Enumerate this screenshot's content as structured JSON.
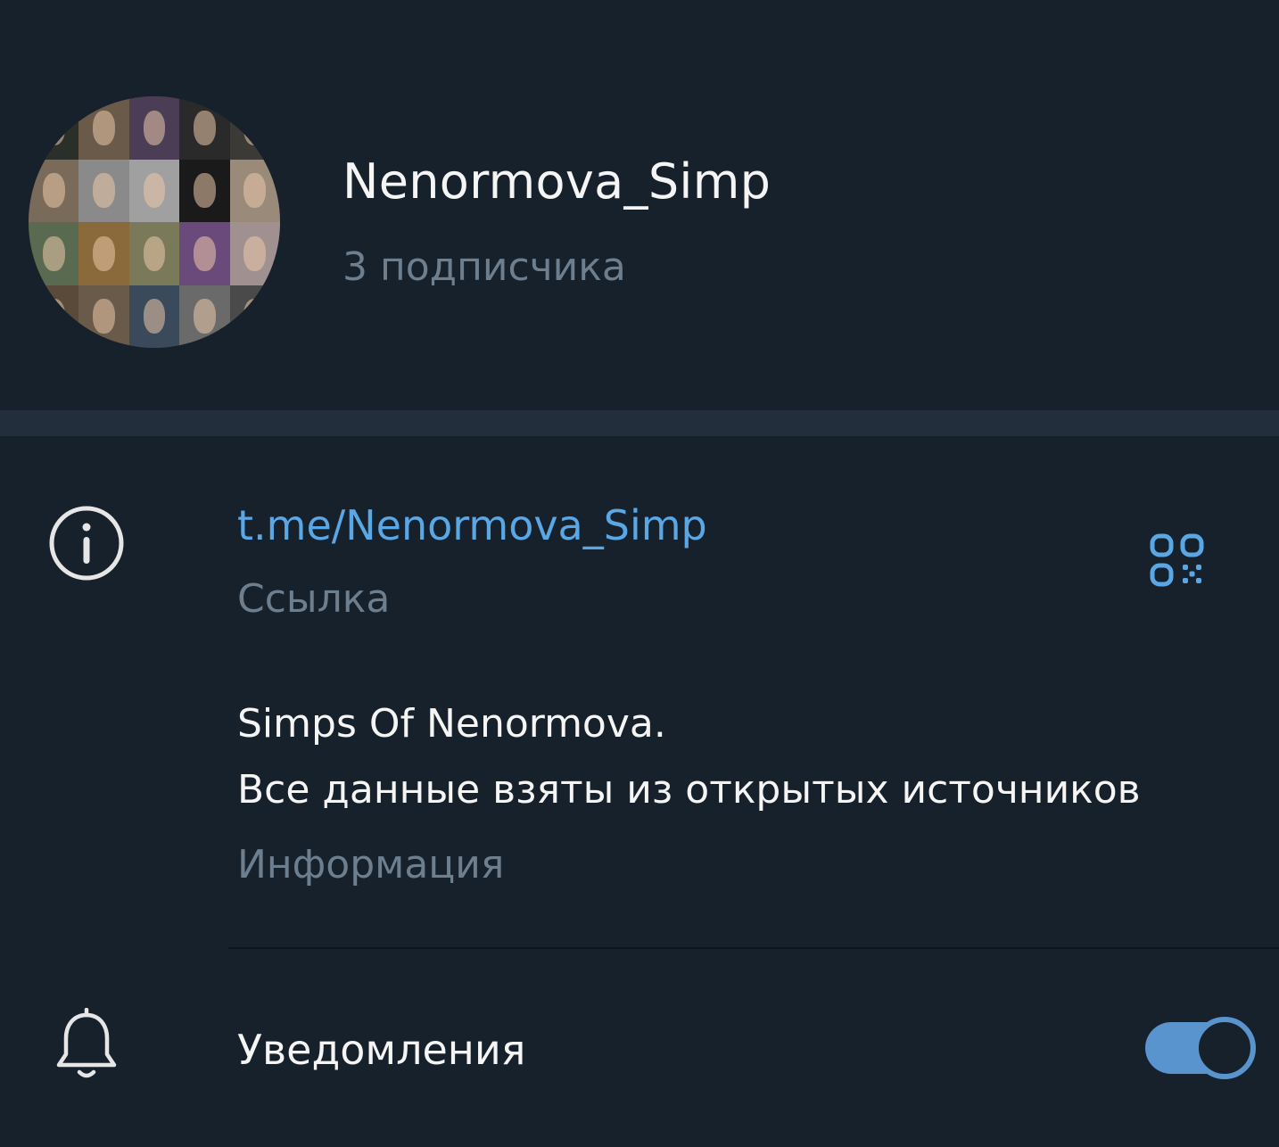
{
  "channel": {
    "name": "Nenormova_Simp",
    "subscribers": "3 подписчика"
  },
  "link": {
    "url": "t.me/Nenormova_Simp",
    "caption": "Ссылка"
  },
  "description": {
    "line1": "Simps Of Nenormova.",
    "line2": "Все данные взяты из открытых источников",
    "caption": "Информация"
  },
  "notifications": {
    "label": "Уведомления",
    "enabled": true
  },
  "icons": {
    "info": "info-icon",
    "qr": "qr-code-icon",
    "bell": "bell-icon"
  },
  "colors": {
    "background": "#17212b",
    "section_divider": "#232e3c",
    "accent": "#5aa7e6",
    "toggle": "#5a94cf",
    "primary_text": "#f5f5f5",
    "secondary_text": "#6d7f8f"
  },
  "avatar": {
    "tile_colors": [
      "#2b2f2a",
      "#6a5a4a",
      "#4a3d55",
      "#2a2a2a",
      "#3b3a36",
      "#7a6a5a",
      "#8a8a8a",
      "#a0a0a0",
      "#1a1a1a",
      "#9a8a7a",
      "#5a6a50",
      "#8a6a3a",
      "#7a7a5a",
      "#6a4a7a",
      "#a09090",
      "#5a4a3a",
      "#6a5a4a",
      "#3a4a5a",
      "#6a6a6a",
      "#4a4a4a"
    ]
  }
}
